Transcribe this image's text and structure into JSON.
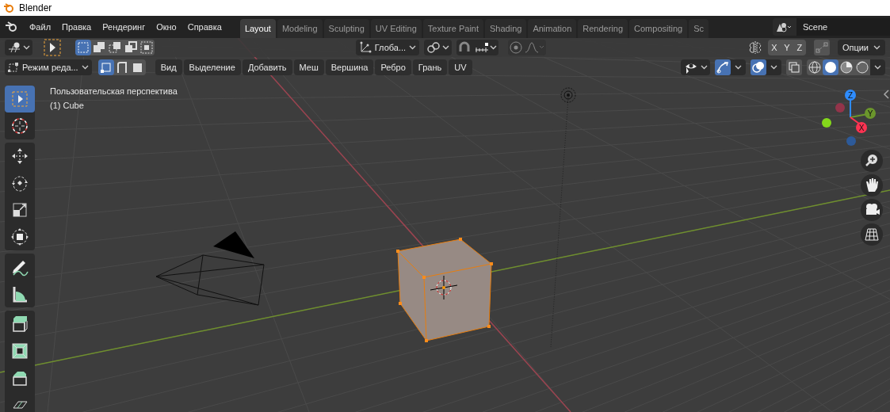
{
  "window": {
    "title": "Blender"
  },
  "menu": [
    "Файл",
    "Правка",
    "Рендеринг",
    "Окно",
    "Справка"
  ],
  "workspace_tabs": [
    {
      "label": "Layout",
      "selected": true
    },
    {
      "label": "Modeling",
      "selected": false
    },
    {
      "label": "Sculpting",
      "selected": false
    },
    {
      "label": "UV Editing",
      "selected": false
    },
    {
      "label": "Texture Paint",
      "selected": false
    },
    {
      "label": "Shading",
      "selected": false
    },
    {
      "label": "Animation",
      "selected": false
    },
    {
      "label": "Rendering",
      "selected": false
    },
    {
      "label": "Compositing",
      "selected": false
    },
    {
      "label": "Sc",
      "selected": false
    }
  ],
  "scene": {
    "value": "Scene"
  },
  "tool_header": {
    "select_modes": [
      {
        "kind": "set",
        "selected": true
      },
      {
        "kind": "extend",
        "selected": false
      },
      {
        "kind": "subtract",
        "selected": false
      },
      {
        "kind": "invert",
        "selected": false
      },
      {
        "kind": "intersect",
        "selected": false
      }
    ],
    "orientation": "Глоба...",
    "mirror_axes": [
      "X",
      "Y",
      "Z"
    ],
    "options": "Опции"
  },
  "viewport_header": {
    "mode": "Режим реда...",
    "element_modes": [
      {
        "kind": "vertex",
        "selected": true
      },
      {
        "kind": "edge",
        "selected": false
      },
      {
        "kind": "face",
        "selected": false
      }
    ],
    "menus": [
      "Вид",
      "Выделение",
      "Добавить",
      "Меш",
      "Вершина",
      "Ребро",
      "Грань",
      "UV"
    ],
    "shading": [
      {
        "kind": "wireframe",
        "selected": false
      },
      {
        "kind": "solid",
        "selected": true
      },
      {
        "kind": "material",
        "selected": false
      },
      {
        "kind": "rendered",
        "selected": false
      }
    ]
  },
  "viewport": {
    "view_name": "Пользовательская перспектива",
    "object_info": "(1) Cube",
    "gizmo_axes": [
      "Z",
      "Y",
      "X"
    ]
  },
  "toolbar": {
    "groups": [
      [
        {
          "kind": "select",
          "selected": true
        },
        {
          "kind": "cursor",
          "selected": false
        }
      ],
      [
        {
          "kind": "move",
          "selected": false
        },
        {
          "kind": "rotate",
          "selected": false
        },
        {
          "kind": "scale",
          "selected": false
        },
        {
          "kind": "transform",
          "selected": false
        }
      ],
      [
        {
          "kind": "annotate",
          "selected": false
        },
        {
          "kind": "measure",
          "selected": false
        }
      ],
      [
        {
          "kind": "extrude",
          "selected": false
        },
        {
          "kind": "inset",
          "selected": false
        },
        {
          "kind": "bevel",
          "selected": false
        },
        {
          "kind": "loopcut",
          "selected": false
        }
      ]
    ]
  }
}
